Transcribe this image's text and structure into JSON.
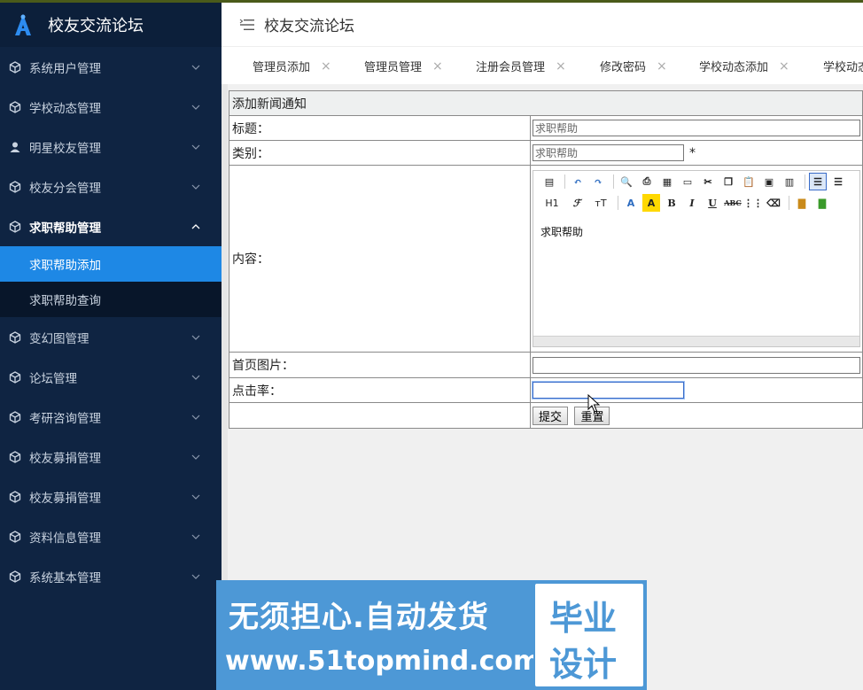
{
  "brand": {
    "title": "校友交流论坛"
  },
  "header": {
    "title": "校友交流论坛"
  },
  "sidebar": {
    "items": [
      {
        "label": "系统用户管理",
        "icon": "cube-icon"
      },
      {
        "label": "学校动态管理",
        "icon": "cube-icon"
      },
      {
        "label": "明星校友管理",
        "icon": "user-icon"
      },
      {
        "label": "校友分会管理",
        "icon": "cube-icon"
      },
      {
        "label": "求职帮助管理",
        "icon": "cube-icon",
        "open": true,
        "children": [
          {
            "label": "求职帮助添加",
            "active": true
          },
          {
            "label": "求职帮助查询"
          }
        ]
      },
      {
        "label": "变幻图管理",
        "icon": "cube-icon"
      },
      {
        "label": "论坛管理",
        "icon": "cube-icon"
      },
      {
        "label": "考研咨询管理",
        "icon": "cube-icon"
      },
      {
        "label": "校友募捐管理",
        "icon": "cube-icon"
      },
      {
        "label": "校友募捐管理",
        "icon": "cube-icon"
      },
      {
        "label": "资料信息管理",
        "icon": "cube-icon"
      },
      {
        "label": "系统基本管理",
        "icon": "cube-icon"
      }
    ]
  },
  "tabs": [
    {
      "label": "管理员添加"
    },
    {
      "label": "管理员管理"
    },
    {
      "label": "注册会员管理"
    },
    {
      "label": "修改密码"
    },
    {
      "label": "学校动态添加"
    },
    {
      "label": "学校动态"
    }
  ],
  "form": {
    "caption": "添加新闻通知",
    "title_label": "标题：",
    "title_value": "求职帮助",
    "category_label": "类别：",
    "category_value": "求职帮助",
    "required_mark": "*",
    "content_label": "内容：",
    "content_value": "求职帮助",
    "image_label": "首页图片：",
    "image_value": "",
    "clicks_label": "点击率：",
    "clicks_value": "",
    "submit_label": "提交",
    "reset_label": "重置"
  },
  "editor_toolbar": {
    "h1": "H1",
    "font": "ℱ",
    "size": "тT",
    "color": "A",
    "bg": "A",
    "bold": "B",
    "italic": "I",
    "underline": "U",
    "strike": "ABC"
  },
  "watermark": {
    "line1": "无须担心.自动发货",
    "line2": "www.51topmind.com",
    "right1": "毕业",
    "right2": "设计"
  },
  "colors": {
    "sidebar_bg": "#0f2442",
    "active_blue": "#1e88e5",
    "watermark_blue": "#4d98d6"
  }
}
